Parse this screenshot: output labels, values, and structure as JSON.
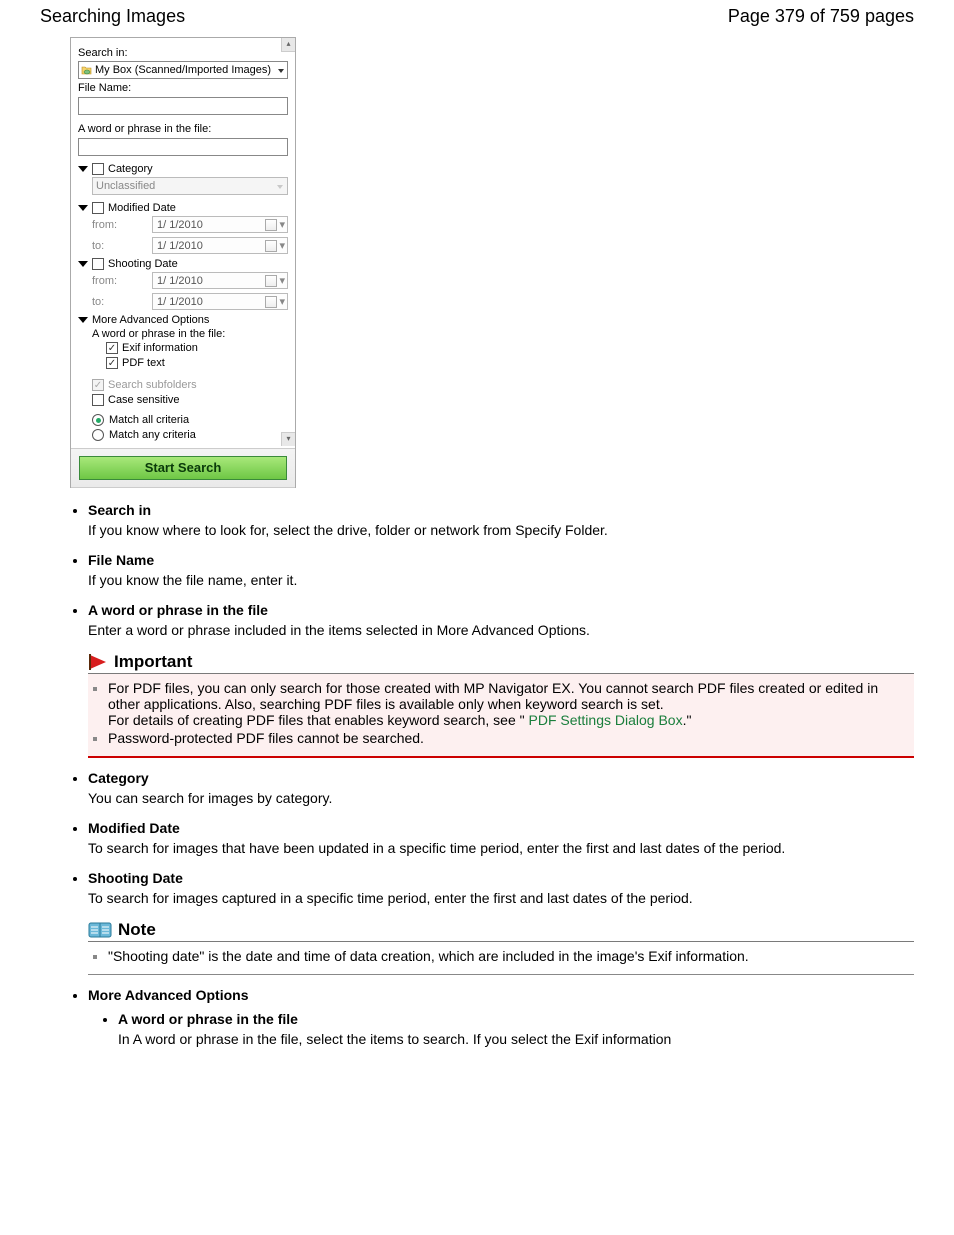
{
  "header": {
    "title": "Searching Images",
    "page_indicator": "Page 379 of 759 pages"
  },
  "panel": {
    "search_in_label": "Search in:",
    "search_in_value": "My Box (Scanned/Imported Images)",
    "file_name_label": "File Name:",
    "file_name_value": "",
    "word_phrase_label": "A word or phrase in the file:",
    "word_phrase_value": "",
    "category_label": "Category",
    "category_value": "Unclassified",
    "modified_date_label": "Modified Date",
    "shooting_date_label": "Shooting Date",
    "from_label": "from:",
    "to_label": "to:",
    "date_value": "1/ 1/2010",
    "more_adv_label": "More Advanced Options",
    "adv_word_label": "A word or phrase in the file:",
    "exif_info_label": "Exif information",
    "pdf_text_label": "PDF text",
    "search_subfolders_label": "Search subfolders",
    "case_sensitive_label": "Case sensitive",
    "match_all_label": "Match all criteria",
    "match_any_label": "Match any criteria",
    "start_button": "Start Search"
  },
  "definitions": {
    "search_in": {
      "term": "Search in",
      "desc": "If you know where to look for, select the drive, folder or network from Specify Folder."
    },
    "file_name": {
      "term": "File Name",
      "desc": "If you know the file name, enter it."
    },
    "word_phrase": {
      "term": "A word or phrase in the file",
      "desc": "Enter a word or phrase included in the items selected in More Advanced Options."
    },
    "category": {
      "term": "Category",
      "desc": "You can search for images by category."
    },
    "modified_date": {
      "term": "Modified Date",
      "desc": "To search for images that have been updated in a specific time period, enter the first and last dates of the period."
    },
    "shooting_date": {
      "term": "Shooting Date",
      "desc": "To search for images captured in a specific time period, enter the first and last dates of the period."
    },
    "more_adv": {
      "term": "More Advanced Options"
    },
    "sub_word": {
      "term": "A word or phrase in the file",
      "desc": "In A word or phrase in the file, select the items to search. If you select the Exif information"
    }
  },
  "important": {
    "title": "Important",
    "item1a": "For PDF files, you can only search for those created with MP Navigator EX. You cannot search PDF files created or edited in other applications. Also, searching PDF files is available only when keyword search is set.",
    "item1b_pre": "For details of creating PDF files that enables keyword search, see \" ",
    "item1b_link": "PDF Settings Dialog Box",
    "item1b_post": ".\"",
    "item2": "Password-protected PDF files cannot be searched."
  },
  "note": {
    "title": "Note",
    "item1": "\"Shooting date\" is the date and time of data creation, which are included in the image's Exif information."
  }
}
